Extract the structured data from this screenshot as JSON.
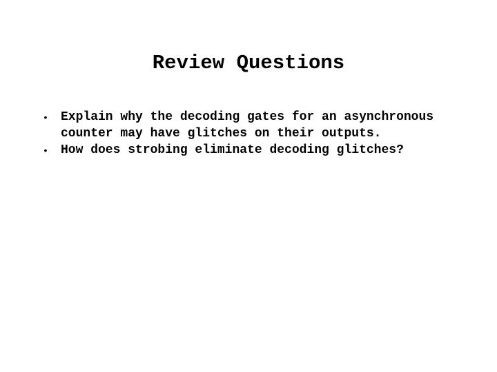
{
  "slide": {
    "title": "Review Questions",
    "bullets": [
      {
        "text": "Explain why the decoding gates for an asynchronous counter may have glitches on their outputs."
      },
      {
        "text": "How does strobing eliminate decoding glitches?"
      }
    ],
    "bullet_glyph": "•"
  }
}
